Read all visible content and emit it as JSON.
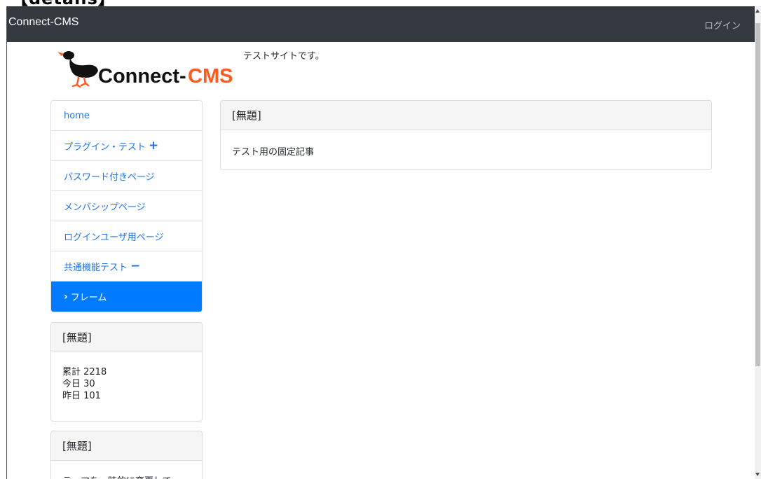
{
  "navbar": {
    "brand": "Connect-CMS",
    "login": "ログイン"
  },
  "header": {
    "logo_text": "Connect-CMS",
    "site_description": "テストサイトです。"
  },
  "menu": {
    "items": [
      {
        "label": "home"
      },
      {
        "label": "プラグイン・テスト",
        "sign": "+"
      },
      {
        "label": "パスワード付きページ"
      },
      {
        "label": "メンバシップページ"
      },
      {
        "label": "ログインユーザ用ページ"
      },
      {
        "label": "共通機能テスト",
        "sign": "−"
      },
      {
        "label": "フレーム",
        "chevron": "›",
        "active": true
      }
    ]
  },
  "main_panel": {
    "title": "[無題]",
    "body": "テスト用の固定記事"
  },
  "counter_panel": {
    "title": "[無題]",
    "total": "累計 2218",
    "today": "今日 30",
    "yesterday": "昨日 101"
  },
  "theme_panel": {
    "title": "[無題]",
    "body": "テーマを一時的に変更して"
  },
  "colors": {
    "navbar": "#343a40",
    "link": "#1e73e8",
    "active": "#007bff",
    "logo_accent": "#ff5a1f"
  }
}
